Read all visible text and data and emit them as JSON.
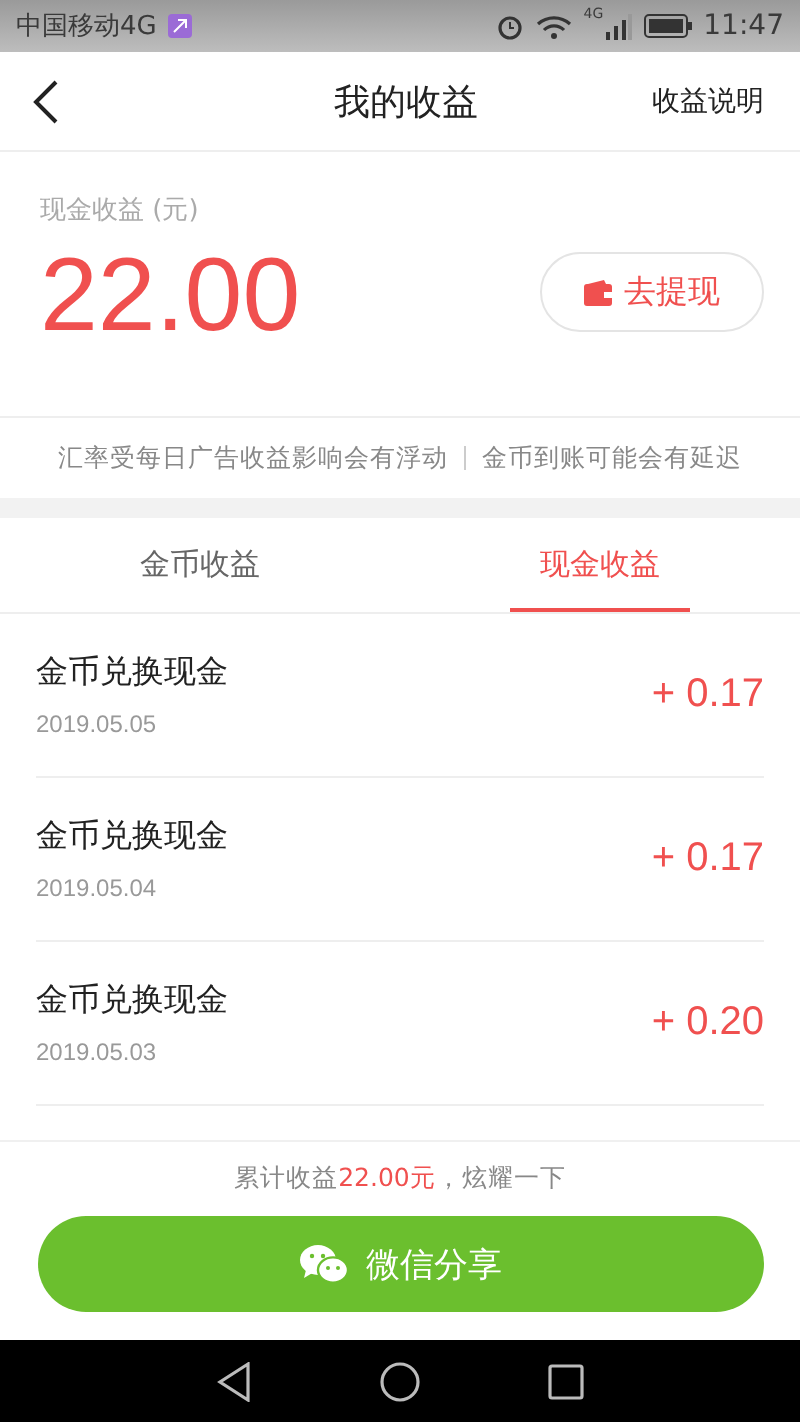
{
  "status_bar": {
    "carrier": "中国移动4G",
    "network": "4G",
    "time": "11:47"
  },
  "header": {
    "title": "我的收益",
    "action": "收益说明"
  },
  "balance": {
    "label": "现金收益 (元)",
    "amount": "22.00",
    "withdraw": "去提现"
  },
  "notice": [
    "汇率受每日广告收益影响会有浮动",
    "金币到账可能会有延迟"
  ],
  "tabs": [
    {
      "label": "金币收益",
      "selected": false
    },
    {
      "label": "现金收益",
      "selected": true
    }
  ],
  "records": [
    {
      "title": "金币兑换现金",
      "date": "2019.05.05",
      "amount": "+ 0.17"
    },
    {
      "title": "金币兑换现金",
      "date": "2019.05.04",
      "amount": "+ 0.17"
    },
    {
      "title": "金币兑换现金",
      "date": "2019.05.03",
      "amount": "+ 0.20"
    }
  ],
  "summary": {
    "prefix": "累计收益",
    "amount": "22.00元",
    "suffix": "，炫耀一下"
  },
  "share_button": "微信分享"
}
